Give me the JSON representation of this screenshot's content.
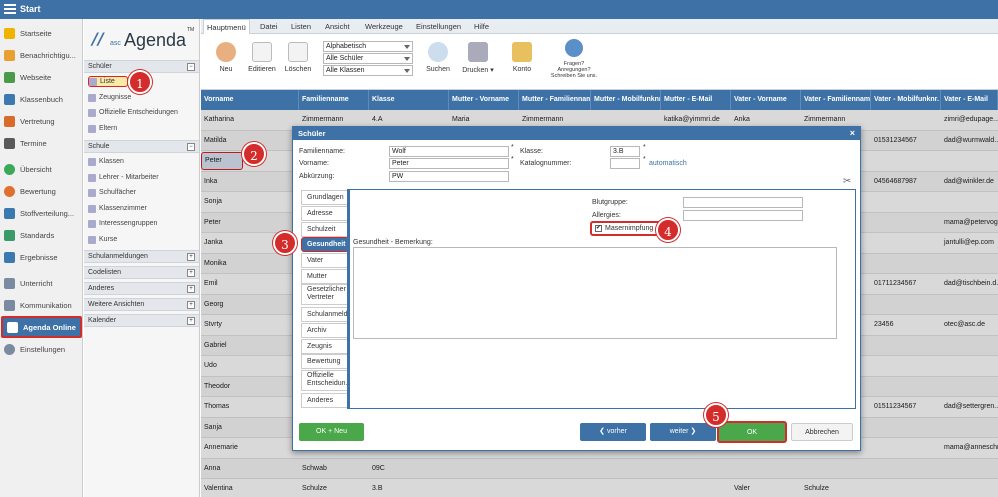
{
  "app": {
    "title": "Start"
  },
  "leftnav": [
    {
      "label": "Startseite",
      "icon": "star-icon",
      "color": "#f0b400"
    },
    {
      "label": "Benachrichtigu...",
      "icon": "mail-icon",
      "color": "#e8a030"
    },
    {
      "label": "Webseite",
      "icon": "home-icon",
      "color": "#4a9a4a"
    },
    {
      "label": "Klassenbuch",
      "icon": "book-icon",
      "color": "#3a7ab0"
    },
    {
      "label": "Vertretung",
      "icon": "swap-icon",
      "color": "#d86a2a"
    },
    {
      "label": "Termine",
      "icon": "calendar-icon",
      "color": "#5a5a5a"
    },
    {
      "label": "Übersicht",
      "icon": "check-icon",
      "color": "#3aaa5a"
    },
    {
      "label": "Bewertung",
      "icon": "rating-icon",
      "color": "#e07030"
    },
    {
      "label": "Stoffverteilung...",
      "icon": "list-icon",
      "color": "#3a7ab0"
    },
    {
      "label": "Standards",
      "icon": "shield-icon",
      "color": "#3a9a6a"
    },
    {
      "label": "Ergebnisse",
      "icon": "chart-icon",
      "color": "#3a7ab0"
    },
    {
      "label": "Unterricht",
      "icon": "lesson-icon",
      "color": "#7a8aa0"
    },
    {
      "label": "Kommunikation",
      "icon": "chat-icon",
      "color": "#7a8aa0"
    },
    {
      "label": "Agenda Online",
      "icon": "agenda-icon",
      "color": "#ffffff"
    },
    {
      "label": "Einstellungen",
      "icon": "gear-icon",
      "color": "#7a8aa0"
    }
  ],
  "secnav": {
    "logo": {
      "mark": "//",
      "asc": "asc",
      "name": "Agenda",
      "tm": "TM"
    },
    "schueler_head": "Schüler",
    "schueler_items": [
      "Liste",
      "Zeugnisse",
      "Offizielle Entscheidungen",
      "Eltern"
    ],
    "schule_head": "Schule",
    "schule_items": [
      "Klassen",
      "Lehrer - Mitarbeiter",
      "Schulfächer",
      "Klassenzimmer",
      "Interessengruppen",
      "Kurse"
    ],
    "other_heads": [
      "Schulanmeldungen",
      "Codelisten",
      "Anderes",
      "Weitere Ansichten",
      "Kalender"
    ],
    "pm_minus": "−",
    "pm_plus": "+"
  },
  "ribbon": {
    "tabs": [
      "Hauptmenü",
      "Datei",
      "Listen",
      "Ansicht",
      "Werkzeuge",
      "Einstellungen",
      "Hilfe"
    ],
    "buttons": [
      "Neu",
      "Editieren",
      "Löschen"
    ],
    "selects": [
      "Alphabetisch",
      "Alle Schüler",
      "Alle Klassen"
    ],
    "buttons2": [
      "Suchen",
      "Drucken",
      "Konto"
    ],
    "drucken_arrow": "▾",
    "help": "Fragen?\nAnregungen?\nSchreiben Sie uns."
  },
  "grid": {
    "headers": [
      "Vorname",
      "Familienname",
      "Klasse",
      "Mutter - Vorname",
      "Mutter - Familienname",
      "Mutter - Mobilfunknr.",
      "Mutter - E-Mail",
      "Vater - Vorname",
      "Vater - Familienname",
      "Vater - Mobilfunknr.",
      "Vater - E-Mail"
    ],
    "rows": [
      [
        "Katharina",
        "Zimmermann",
        "4.A",
        "Maria",
        "Zimmermann",
        "",
        "katika@yimmri.de",
        "Anka",
        "Zimmermann",
        "",
        "zimri@edupage..."
      ],
      [
        "Matilda",
        "",
        "",
        "",
        "",
        "",
        "",
        "",
        "",
        "01531234567",
        "dad@wurmwald..."
      ],
      [
        "Peter",
        "",
        "",
        "",
        "",
        "",
        "",
        "",
        "",
        "",
        ""
      ],
      [
        "Inka",
        "",
        "",
        "",
        "",
        "",
        "",
        "",
        "",
        "04564687987",
        "dad@winkler.de"
      ],
      [
        "Sonja",
        "",
        "",
        "",
        "",
        "",
        "",
        "",
        "",
        "",
        ""
      ],
      [
        "Peter",
        "",
        "",
        "",
        "",
        "",
        "",
        "",
        "",
        "",
        "mama@petervog..."
      ],
      [
        "Janka",
        "",
        "",
        "",
        "",
        "",
        "",
        "",
        "",
        "",
        "jantulli@ep.com"
      ],
      [
        "Monika",
        "",
        "",
        "",
        "",
        "",
        "",
        "",
        "",
        "",
        ""
      ],
      [
        "Emil",
        "",
        "",
        "",
        "",
        "",
        "",
        "",
        "",
        "01711234567",
        "dad@tischbein.d..."
      ],
      [
        "Georg",
        "",
        "",
        "",
        "",
        "",
        "",
        "",
        "",
        "",
        ""
      ],
      [
        "Stvrty",
        "",
        "",
        "",
        "",
        "",
        "",
        "",
        "",
        "23456",
        "otec@asc.de"
      ],
      [
        "Gabriel",
        "",
        "",
        "",
        "",
        "",
        "",
        "",
        "",
        "",
        ""
      ],
      [
        "Udo",
        "",
        "",
        "",
        "",
        "",
        "",
        "",
        "",
        "",
        ""
      ],
      [
        "Theodor",
        "",
        "",
        "",
        "",
        "",
        "",
        "",
        "",
        "",
        ""
      ],
      [
        "Thomas",
        "",
        "",
        "",
        "",
        "",
        "",
        "",
        "",
        "01511234567",
        "dad@settergren..."
      ],
      [
        "Sanja",
        "",
        "",
        "",
        "",
        "",
        "",
        "",
        "",
        "",
        ""
      ],
      [
        "Annemarie",
        "",
        "",
        "",
        "",
        "",
        "",
        "",
        "",
        "",
        "mama@anneschr..."
      ],
      [
        "Anna",
        "Schwab",
        "09C",
        "",
        "",
        "",
        "",
        "",
        "",
        "",
        ""
      ],
      [
        "Valentina",
        "Schulze",
        "3.B",
        "",
        "",
        "",
        "",
        "Valer",
        "Schulze",
        "",
        ""
      ]
    ]
  },
  "dialog": {
    "title": "Schüler",
    "close": "×",
    "fields": {
      "familienname_label": "Familienname:",
      "familienname": "Wolf",
      "vorname_label": "Vorname:",
      "vorname": "Peter",
      "abk_label": "Abkürzung:",
      "abk": "PW",
      "klasse_label": "Klasse:",
      "klasse": "3.B",
      "katalog_label": "Katalognummer:",
      "katalog": "",
      "automatisch": "automatisch",
      "req": "*"
    },
    "tabs": [
      "Grundlagen",
      "Adresse",
      "Schulzeit",
      "Gesundheit",
      "Vater",
      "Mutter",
      "Gesetzlicher Vertreter",
      "Schulanmeld...",
      "Archiv",
      "Zeugnis",
      "Bewertung",
      "Offizielle Entscheidun...",
      "Anderes"
    ],
    "panel": {
      "blutgruppe_label": "Blutgruppe:",
      "blutgruppe": "",
      "allergies_label": "Allergies:",
      "allergies": "",
      "masern_label": "Masernimpfung",
      "masern_checked": true,
      "bemerkung_label": "Gesundheit - Bemerkung:",
      "bemerkung": ""
    },
    "buttons": {
      "ok_neu": "OK + Neu",
      "vorher": "vorher",
      "weiter": "weiter",
      "ok": "OK",
      "abbrechen": "Abbrechen"
    }
  },
  "markers": [
    "1",
    "2",
    "3",
    "4",
    "5"
  ],
  "colors": {
    "accent": "#3e72a6",
    "ok": "#4aa84a",
    "marker": "#d42b2b"
  }
}
